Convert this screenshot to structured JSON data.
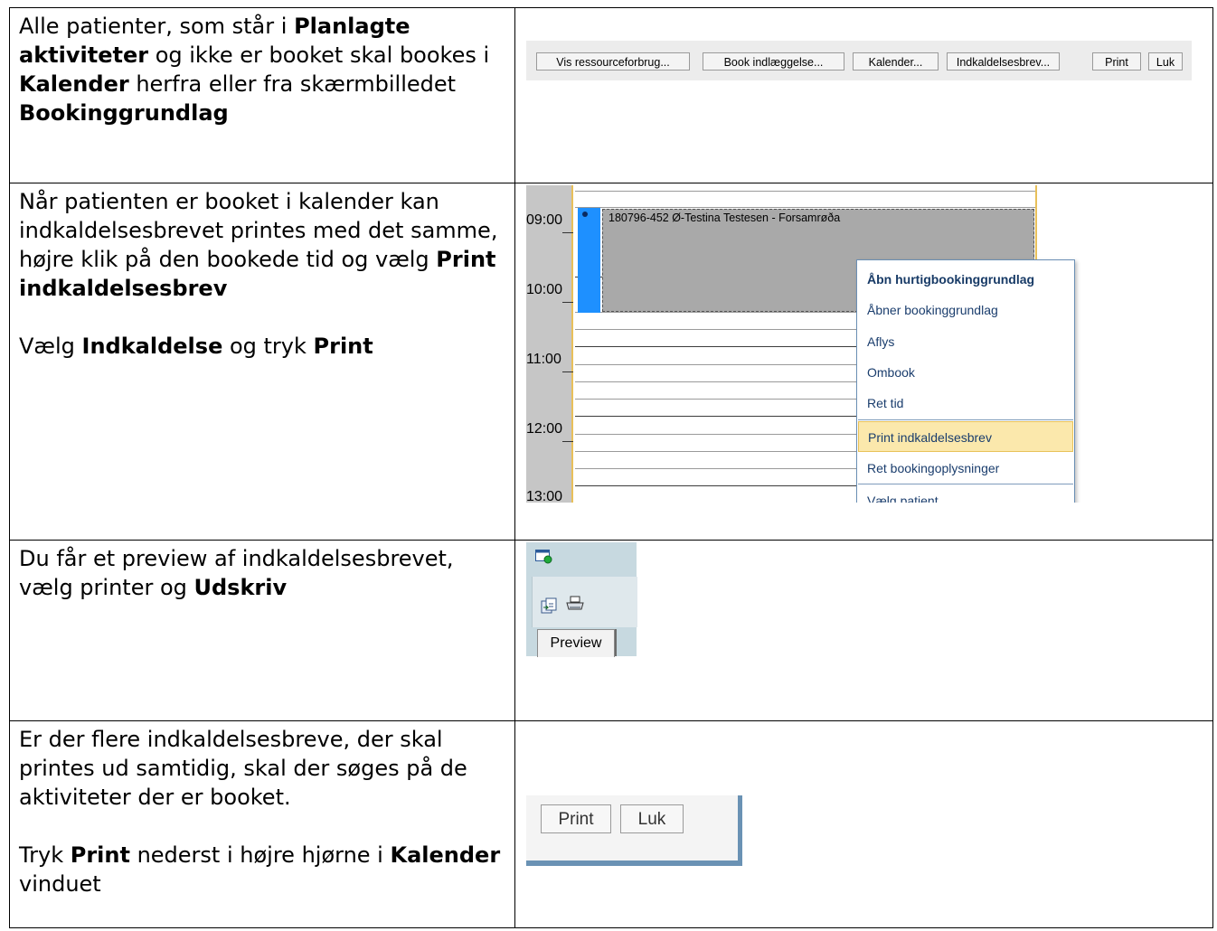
{
  "rows": [
    {
      "text": {
        "p1": [
          "Alle patienter, som står i ",
          "Planlagte aktiviteter",
          " og ikke er booket skal bookes i ",
          "Kalender",
          " herfra eller fra skærmbilledet ",
          "Bookinggrundlag"
        ]
      },
      "toolbar": {
        "buttons": [
          "Vis ressourceforbrug...",
          "Book indlæggelse...",
          "Kalender...",
          "Indkaldelsesbrev...",
          "Print",
          "Luk"
        ]
      }
    },
    {
      "text": {
        "p1": [
          "Når patienten er booket i kalender kan indkaldelsesbrevet printes med det samme, højre klik på den bookede tid og vælg ",
          "Print indkaldelsesbrev"
        ],
        "p2": [
          "Vælg ",
          "Indkaldelse",
          " og tryk ",
          "Print"
        ]
      },
      "calendar": {
        "times": [
          "09:00",
          "10:00",
          "11:00",
          "12:00",
          "13:00"
        ],
        "appointment": "180796-452  Ø-Testina Testesen - Forsamrøða",
        "context_menu": [
          "Åbn hurtigbookinggrundlag",
          "Åbner bookinggrundlag",
          "Aflys",
          "Ombook",
          "Ret tid",
          "Print indkaldelsesbrev",
          "Ret bookingoplysninger",
          "Vælg patient"
        ],
        "highlight_color": "#fbe8ac"
      }
    },
    {
      "text": {
        "p1": [
          "Du får et preview af indkaldelsesbrevet, vælg printer og ",
          "Udskriv"
        ]
      },
      "preview": {
        "tab_label": "Preview"
      }
    },
    {
      "text": {
        "p1": [
          "Er der flere indkaldelsesbreve, der skal printes ud samtidig, skal der søges på de aktiviteter der er booket."
        ],
        "p2": [
          "Tryk ",
          "Print",
          " nederst i højre hjørne i ",
          "Kalender",
          " vinduet"
        ]
      },
      "buttons": [
        "Print",
        "Luk"
      ]
    }
  ]
}
